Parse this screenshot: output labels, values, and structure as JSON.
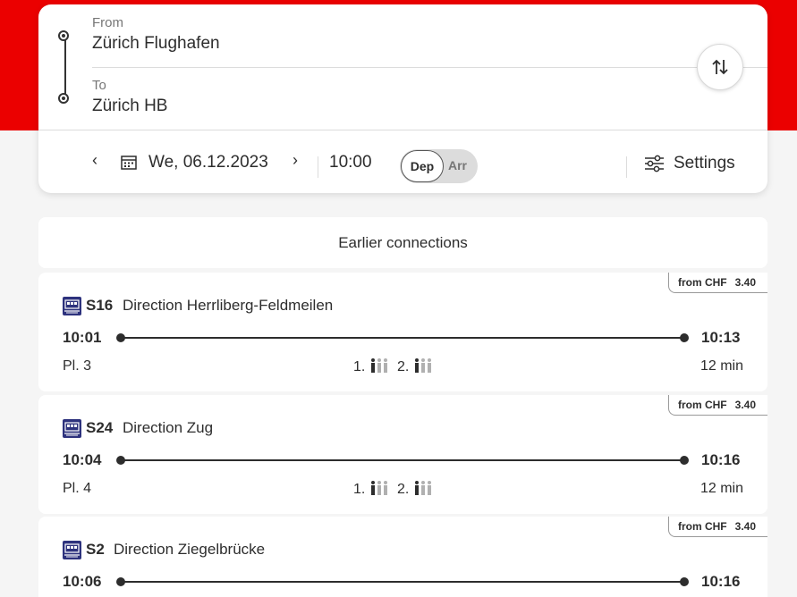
{
  "search": {
    "from_label": "From",
    "from_value": "Zürich Flughafen",
    "to_label": "To",
    "to_value": "Zürich HB",
    "date": "We, 06.12.2023",
    "time": "10:00",
    "dep_label": "Dep",
    "arr_label": "Arr",
    "settings_label": "Settings"
  },
  "earlier_label": "Earlier connections",
  "connections": [
    {
      "price": "from CHF",
      "price_value": "3.40",
      "line": "S16",
      "direction": "Direction Herrliberg-Feldmeilen",
      "dep": "10:01",
      "arr": "10:13",
      "platform": "Pl. 3",
      "class1": "1.",
      "class2": "2.",
      "duration": "12 min"
    },
    {
      "price": "from CHF",
      "price_value": "3.40",
      "line": "S24",
      "direction": "Direction Zug",
      "dep": "10:04",
      "arr": "10:16",
      "platform": "Pl. 4",
      "class1": "1.",
      "class2": "2.",
      "duration": "12 min"
    },
    {
      "price": "from CHF",
      "price_value": "3.40",
      "line": "S2",
      "direction": "Direction Ziegelbrücke",
      "dep": "10:06",
      "arr": "10:16"
    }
  ],
  "colors": {
    "brand_red": "#eb0000",
    "train_blue": "#2d327d"
  }
}
